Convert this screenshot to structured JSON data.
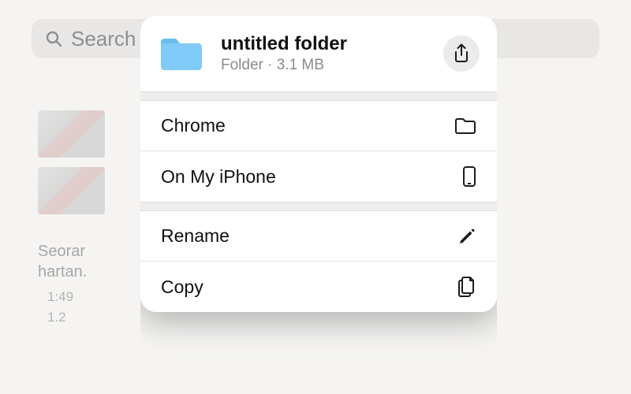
{
  "search": {
    "placeholder": "Search"
  },
  "background": {
    "line1": "Seorar",
    "line2": "hartan.",
    "time1": "1:49",
    "time2": "1.2"
  },
  "sheet": {
    "title": "untitled folder",
    "subtitle": "Folder · 3.1 MB",
    "sectionA": [
      {
        "label": "Chrome",
        "icon": "folder-outline-icon"
      },
      {
        "label": "On My iPhone",
        "icon": "iphone-icon"
      }
    ],
    "sectionB": [
      {
        "label": "Rename",
        "icon": "pencil-icon"
      },
      {
        "label": "Copy",
        "icon": "duplicate-icon"
      }
    ]
  }
}
